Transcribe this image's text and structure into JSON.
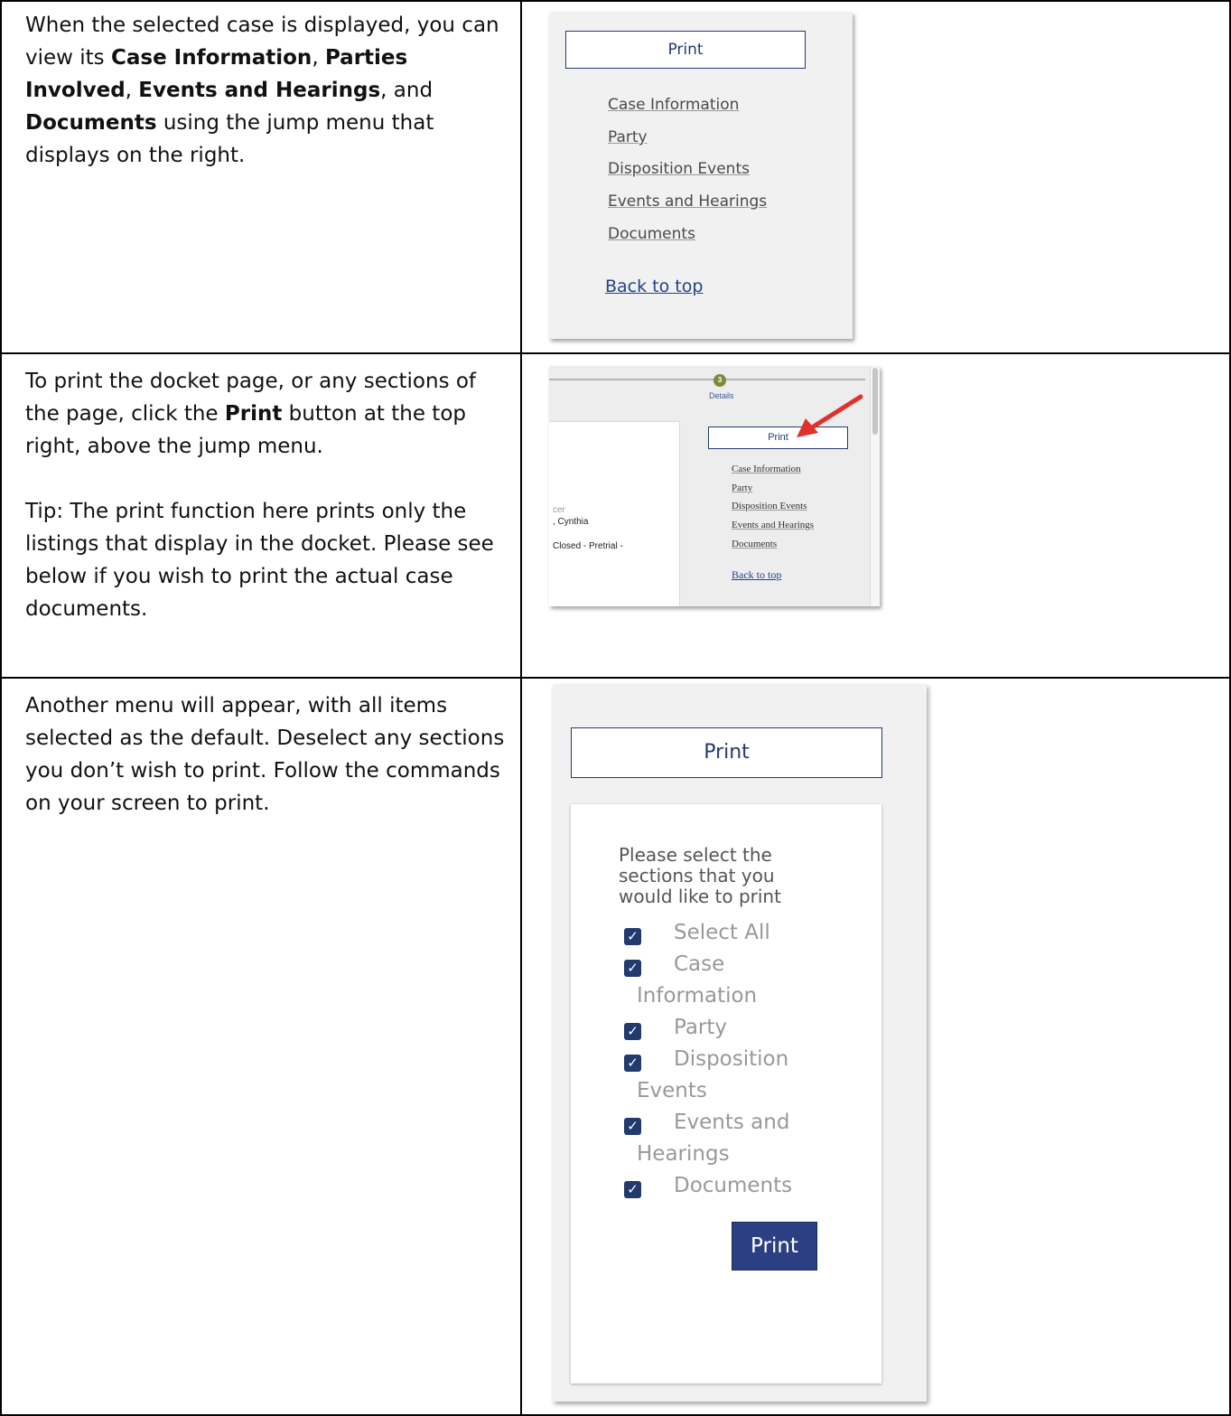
{
  "rows": [
    {
      "instruction": {
        "seg1": "When the selected case is displayed, you can view its ",
        "b1": "Case Information",
        "seg2": ", ",
        "b2": "Parties Involved",
        "seg3": ", ",
        "b3": "Events and Hearings",
        "seg4": ", and ",
        "b4": "Documents",
        "seg5": " using the jump menu that displays on the right."
      },
      "shot": {
        "print_label": "Print",
        "links": [
          "Case Information",
          "Party",
          "Disposition Events",
          "Events and Hearings",
          "Documents"
        ],
        "back_to_top": "Back to top"
      }
    },
    {
      "instruction": {
        "seg1": "To print the docket page, or any sections of the page, click the ",
        "b1": "Print",
        "seg2": " button at the top right, above the jump menu.",
        "tip": "Tip: The print function here prints only the listings that display in the docket. Please see below if you wish to print the actual case documents."
      },
      "shot": {
        "step_number": "3",
        "step_label": "Details",
        "partial_text": [
          "cer",
          ", Cynthia",
          "Closed - Pretrial -"
        ],
        "print_label": "Print",
        "links": [
          "Case Information",
          "Party",
          "Disposition Events",
          "Events and Hearings",
          "Documents"
        ],
        "back_to_top": "Back to top",
        "arrow_color": "#e0322b"
      }
    },
    {
      "instruction": {
        "text": "Another menu will appear, with all items selected as the default. Deselect any sections you don’t wish to print. Follow the commands on your screen to print."
      },
      "shot": {
        "print_label": "Print",
        "prompt": "Please select the sections that you would like to print",
        "options": {
          "select_all": "Select All",
          "case_1": "Case",
          "case_2": "Information",
          "party": "Party",
          "disp_1": "Disposition",
          "disp_2": "Events",
          "events_1": "Events and",
          "events_2": "Hearings",
          "documents": "Documents"
        },
        "submit_label": "Print"
      }
    }
  ],
  "colors": {
    "navy": "#233a6e",
    "link_blue": "#22428a",
    "button_bg": "#2b3f82",
    "step_green": "#7d8b38"
  }
}
